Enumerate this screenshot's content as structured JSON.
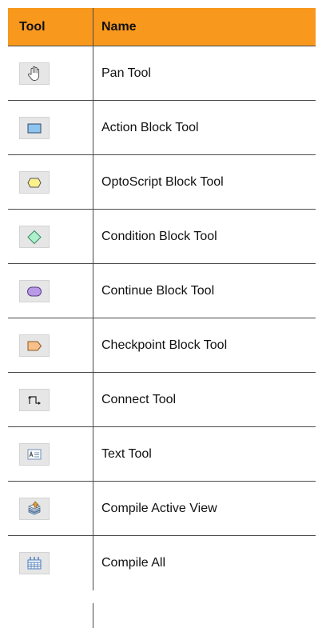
{
  "header": {
    "tool_label": "Tool",
    "name_label": "Name"
  },
  "tools": [
    {
      "name": "Pan Tool",
      "icon": "hand-icon"
    },
    {
      "name": "Action Block Tool",
      "icon": "action-block-icon"
    },
    {
      "name": "OptoScript Block Tool",
      "icon": "optoscript-block-icon"
    },
    {
      "name": "Condition Block Tool",
      "icon": "condition-block-icon"
    },
    {
      "name": "Continue Block Tool",
      "icon": "continue-block-icon"
    },
    {
      "name": "Checkpoint Block Tool",
      "icon": "checkpoint-block-icon"
    },
    {
      "name": "Connect Tool",
      "icon": "connect-icon"
    },
    {
      "name": "Text Tool",
      "icon": "text-icon"
    },
    {
      "name": "Compile Active View",
      "icon": "compile-view-icon"
    },
    {
      "name": "Compile All",
      "icon": "compile-all-icon"
    }
  ],
  "colors": {
    "header_bg": "#f8981d",
    "border": "#4a4a4a"
  }
}
